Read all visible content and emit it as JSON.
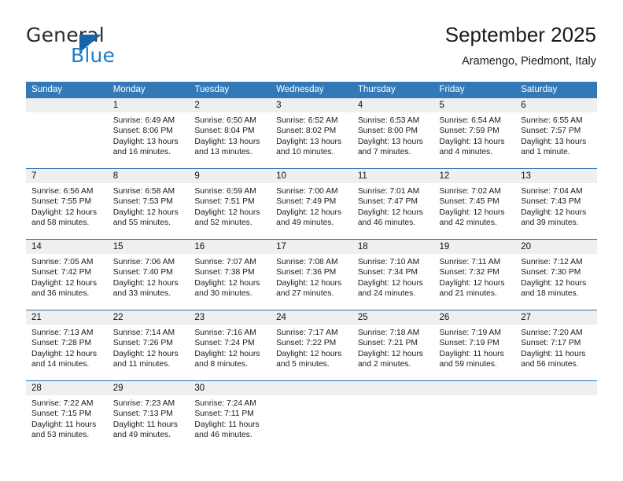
{
  "brand": {
    "name_part1": "General",
    "name_part2": "Blue",
    "logo_icon": "triangle-flag-icon"
  },
  "header": {
    "title": "September 2025",
    "subtitle": "Aramengo, Piedmont, Italy"
  },
  "colors": {
    "header_band": "#3379b8",
    "week_divider": "#2a6fad",
    "daynum_band": "#efefef",
    "brand_blue": "#1d7dc4",
    "text": "#1a1a1a"
  },
  "weekdays": [
    "Sunday",
    "Monday",
    "Tuesday",
    "Wednesday",
    "Thursday",
    "Friday",
    "Saturday"
  ],
  "weeks": [
    [
      {
        "day": "",
        "sunrise": "",
        "sunset": "",
        "daylight_line1": "",
        "daylight_line2": ""
      },
      {
        "day": "1",
        "sunrise": "Sunrise: 6:49 AM",
        "sunset": "Sunset: 8:06 PM",
        "daylight_line1": "Daylight: 13 hours",
        "daylight_line2": "and 16 minutes."
      },
      {
        "day": "2",
        "sunrise": "Sunrise: 6:50 AM",
        "sunset": "Sunset: 8:04 PM",
        "daylight_line1": "Daylight: 13 hours",
        "daylight_line2": "and 13 minutes."
      },
      {
        "day": "3",
        "sunrise": "Sunrise: 6:52 AM",
        "sunset": "Sunset: 8:02 PM",
        "daylight_line1": "Daylight: 13 hours",
        "daylight_line2": "and 10 minutes."
      },
      {
        "day": "4",
        "sunrise": "Sunrise: 6:53 AM",
        "sunset": "Sunset: 8:00 PM",
        "daylight_line1": "Daylight: 13 hours",
        "daylight_line2": "and 7 minutes."
      },
      {
        "day": "5",
        "sunrise": "Sunrise: 6:54 AM",
        "sunset": "Sunset: 7:59 PM",
        "daylight_line1": "Daylight: 13 hours",
        "daylight_line2": "and 4 minutes."
      },
      {
        "day": "6",
        "sunrise": "Sunrise: 6:55 AM",
        "sunset": "Sunset: 7:57 PM",
        "daylight_line1": "Daylight: 13 hours",
        "daylight_line2": "and 1 minute."
      }
    ],
    [
      {
        "day": "7",
        "sunrise": "Sunrise: 6:56 AM",
        "sunset": "Sunset: 7:55 PM",
        "daylight_line1": "Daylight: 12 hours",
        "daylight_line2": "and 58 minutes."
      },
      {
        "day": "8",
        "sunrise": "Sunrise: 6:58 AM",
        "sunset": "Sunset: 7:53 PM",
        "daylight_line1": "Daylight: 12 hours",
        "daylight_line2": "and 55 minutes."
      },
      {
        "day": "9",
        "sunrise": "Sunrise: 6:59 AM",
        "sunset": "Sunset: 7:51 PM",
        "daylight_line1": "Daylight: 12 hours",
        "daylight_line2": "and 52 minutes."
      },
      {
        "day": "10",
        "sunrise": "Sunrise: 7:00 AM",
        "sunset": "Sunset: 7:49 PM",
        "daylight_line1": "Daylight: 12 hours",
        "daylight_line2": "and 49 minutes."
      },
      {
        "day": "11",
        "sunrise": "Sunrise: 7:01 AM",
        "sunset": "Sunset: 7:47 PM",
        "daylight_line1": "Daylight: 12 hours",
        "daylight_line2": "and 46 minutes."
      },
      {
        "day": "12",
        "sunrise": "Sunrise: 7:02 AM",
        "sunset": "Sunset: 7:45 PM",
        "daylight_line1": "Daylight: 12 hours",
        "daylight_line2": "and 42 minutes."
      },
      {
        "day": "13",
        "sunrise": "Sunrise: 7:04 AM",
        "sunset": "Sunset: 7:43 PM",
        "daylight_line1": "Daylight: 12 hours",
        "daylight_line2": "and 39 minutes."
      }
    ],
    [
      {
        "day": "14",
        "sunrise": "Sunrise: 7:05 AM",
        "sunset": "Sunset: 7:42 PM",
        "daylight_line1": "Daylight: 12 hours",
        "daylight_line2": "and 36 minutes."
      },
      {
        "day": "15",
        "sunrise": "Sunrise: 7:06 AM",
        "sunset": "Sunset: 7:40 PM",
        "daylight_line1": "Daylight: 12 hours",
        "daylight_line2": "and 33 minutes."
      },
      {
        "day": "16",
        "sunrise": "Sunrise: 7:07 AM",
        "sunset": "Sunset: 7:38 PM",
        "daylight_line1": "Daylight: 12 hours",
        "daylight_line2": "and 30 minutes."
      },
      {
        "day": "17",
        "sunrise": "Sunrise: 7:08 AM",
        "sunset": "Sunset: 7:36 PM",
        "daylight_line1": "Daylight: 12 hours",
        "daylight_line2": "and 27 minutes."
      },
      {
        "day": "18",
        "sunrise": "Sunrise: 7:10 AM",
        "sunset": "Sunset: 7:34 PM",
        "daylight_line1": "Daylight: 12 hours",
        "daylight_line2": "and 24 minutes."
      },
      {
        "day": "19",
        "sunrise": "Sunrise: 7:11 AM",
        "sunset": "Sunset: 7:32 PM",
        "daylight_line1": "Daylight: 12 hours",
        "daylight_line2": "and 21 minutes."
      },
      {
        "day": "20",
        "sunrise": "Sunrise: 7:12 AM",
        "sunset": "Sunset: 7:30 PM",
        "daylight_line1": "Daylight: 12 hours",
        "daylight_line2": "and 18 minutes."
      }
    ],
    [
      {
        "day": "21",
        "sunrise": "Sunrise: 7:13 AM",
        "sunset": "Sunset: 7:28 PM",
        "daylight_line1": "Daylight: 12 hours",
        "daylight_line2": "and 14 minutes."
      },
      {
        "day": "22",
        "sunrise": "Sunrise: 7:14 AM",
        "sunset": "Sunset: 7:26 PM",
        "daylight_line1": "Daylight: 12 hours",
        "daylight_line2": "and 11 minutes."
      },
      {
        "day": "23",
        "sunrise": "Sunrise: 7:16 AM",
        "sunset": "Sunset: 7:24 PM",
        "daylight_line1": "Daylight: 12 hours",
        "daylight_line2": "and 8 minutes."
      },
      {
        "day": "24",
        "sunrise": "Sunrise: 7:17 AM",
        "sunset": "Sunset: 7:22 PM",
        "daylight_line1": "Daylight: 12 hours",
        "daylight_line2": "and 5 minutes."
      },
      {
        "day": "25",
        "sunrise": "Sunrise: 7:18 AM",
        "sunset": "Sunset: 7:21 PM",
        "daylight_line1": "Daylight: 12 hours",
        "daylight_line2": "and 2 minutes."
      },
      {
        "day": "26",
        "sunrise": "Sunrise: 7:19 AM",
        "sunset": "Sunset: 7:19 PM",
        "daylight_line1": "Daylight: 11 hours",
        "daylight_line2": "and 59 minutes."
      },
      {
        "day": "27",
        "sunrise": "Sunrise: 7:20 AM",
        "sunset": "Sunset: 7:17 PM",
        "daylight_line1": "Daylight: 11 hours",
        "daylight_line2": "and 56 minutes."
      }
    ],
    [
      {
        "day": "28",
        "sunrise": "Sunrise: 7:22 AM",
        "sunset": "Sunset: 7:15 PM",
        "daylight_line1": "Daylight: 11 hours",
        "daylight_line2": "and 53 minutes."
      },
      {
        "day": "29",
        "sunrise": "Sunrise: 7:23 AM",
        "sunset": "Sunset: 7:13 PM",
        "daylight_line1": "Daylight: 11 hours",
        "daylight_line2": "and 49 minutes."
      },
      {
        "day": "30",
        "sunrise": "Sunrise: 7:24 AM",
        "sunset": "Sunset: 7:11 PM",
        "daylight_line1": "Daylight: 11 hours",
        "daylight_line2": "and 46 minutes."
      },
      {
        "day": "",
        "sunrise": "",
        "sunset": "",
        "daylight_line1": "",
        "daylight_line2": ""
      },
      {
        "day": "",
        "sunrise": "",
        "sunset": "",
        "daylight_line1": "",
        "daylight_line2": ""
      },
      {
        "day": "",
        "sunrise": "",
        "sunset": "",
        "daylight_line1": "",
        "daylight_line2": ""
      },
      {
        "day": "",
        "sunrise": "",
        "sunset": "",
        "daylight_line1": "",
        "daylight_line2": ""
      }
    ]
  ]
}
